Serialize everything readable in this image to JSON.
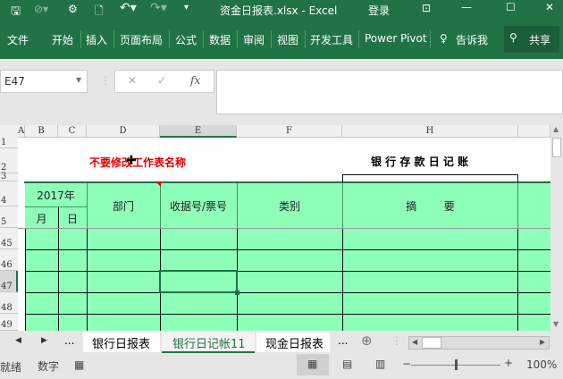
{
  "titlebar": {
    "title": "资金日报表.xlsx  -  Excel",
    "login": "登录"
  },
  "ribbon": {
    "tabs": [
      "文件",
      "开始",
      "插入",
      "页面布局",
      "公式",
      "数据",
      "审阅",
      "视图",
      "开发工具",
      "Power Pivot"
    ],
    "tell_me": "告诉我",
    "share": "共享"
  },
  "formula_bar": {
    "name_box": "E47",
    "formula": ""
  },
  "columns": [
    "A",
    "B",
    "C",
    "D",
    "E",
    "F",
    "H"
  ],
  "rows": [
    "1",
    "2",
    "3",
    "4",
    "5",
    "45",
    "46",
    "47",
    "48",
    "49"
  ],
  "sheet": {
    "warning": "不要修改工作表名称",
    "title": "银 行 存 款 日 记 账",
    "year": "2017年",
    "month": "月",
    "day": "日",
    "dept": "部门",
    "receipt": "收据号/票号",
    "category": "类别",
    "summary": "摘        要"
  },
  "sheet_tabs": {
    "tabs": [
      "银行日报表",
      "银行日记帐11",
      "现金日报表"
    ],
    "active": 1,
    "more": "..."
  },
  "status": {
    "ready": "就绪",
    "num": "数字",
    "zoom": "100%",
    "zoom_level": 100
  },
  "colors": {
    "excel_green": "#217346",
    "fill": "#8effb8",
    "warning": "#e00000"
  }
}
